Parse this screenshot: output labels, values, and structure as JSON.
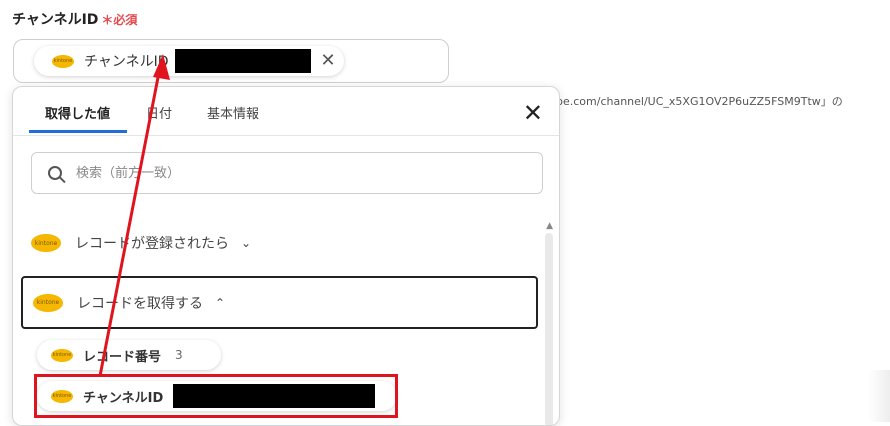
{
  "field": {
    "label": "チャンネルID",
    "required": "＊必須",
    "chip_text": "チャンネルID",
    "chip_icon": "kintone-icon",
    "close_glyph": "✕"
  },
  "background_hint": "be.com/channel/UC_x5XG1OV2P6uZZ5FSM9Ttw」の",
  "panel": {
    "tabs": [
      {
        "label": "取得した値",
        "active": true
      },
      {
        "label": "日付",
        "active": false
      },
      {
        "label": "基本情報",
        "active": false
      }
    ],
    "close_glyph": "✕",
    "search_placeholder": "検索（前方一致）",
    "sections": [
      {
        "label": "レコードが登録されたら",
        "expanded": false,
        "chevron": "⌄"
      },
      {
        "label": "レコードを取得する",
        "expanded": true,
        "chevron": "⌃"
      }
    ],
    "items": [
      {
        "label": "レコード番号",
        "value": "3"
      },
      {
        "label": "チャンネルID",
        "value": ""
      }
    ]
  },
  "icon_text": "kintone",
  "colors": {
    "accent": "#1e6fd9",
    "required": "#e5484d",
    "highlight": "#e0141e",
    "kintone": "#f5b700"
  }
}
